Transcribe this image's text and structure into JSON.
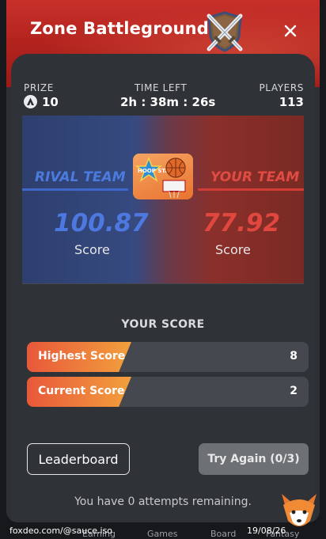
{
  "header": {
    "title": "Zone Battleground",
    "close_icon": "close-icon",
    "emblem_icon": "crossed-swords-shield-icon"
  },
  "stats": {
    "prize_label": "PRIZE",
    "prize_value": "10",
    "time_label": "TIME LEFT",
    "time_value": "2h : 38m : 26s",
    "players_label": "PLAYERS",
    "players_value": "113"
  },
  "teams": {
    "rival_label": "RIVAL TEAM",
    "rival_score": "100.87",
    "rival_score_caption": "Score",
    "your_label": "YOUR TEAM",
    "your_score": "77.92",
    "your_score_caption": "Score",
    "game_title": "HOOP STAR"
  },
  "your_score": {
    "title": "YOUR SCORE",
    "rows": [
      {
        "label": "Highest Score",
        "value": "8"
      },
      {
        "label": "Current Score",
        "value": "2"
      }
    ]
  },
  "actions": {
    "leaderboard": "Leaderboard",
    "try_again": "Try Again (0/3)"
  },
  "attempts_text": "You have 0 attempts remaining.",
  "footer": {
    "watermark": "foxdeo.com/@sauce.iso",
    "date": "19/08/26",
    "nav": [
      "Earning",
      "Games",
      "Board",
      "Fantasy"
    ]
  },
  "colors": {
    "rival": "#3f66c9",
    "your": "#d23c36",
    "accent": "#ef7a3b",
    "header": "#c8302a"
  }
}
